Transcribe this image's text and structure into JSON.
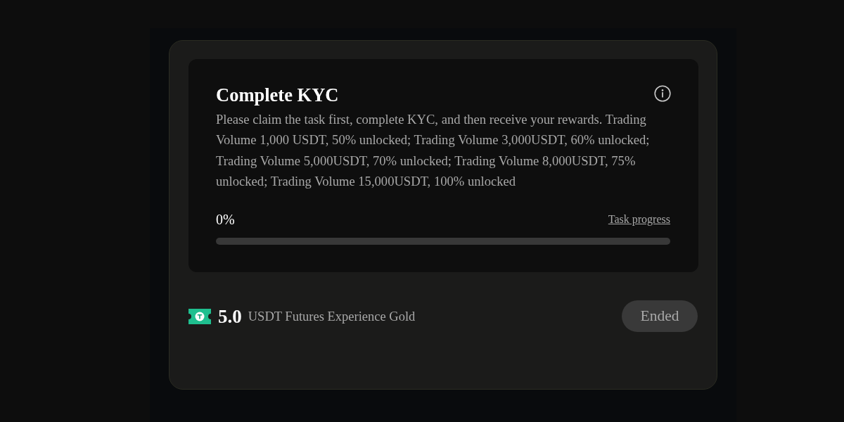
{
  "task": {
    "title": "Complete KYC",
    "description": "Please claim the task first, complete KYC, and then receive your rewards. Trading Volume 1,000 USDT, 50% unlocked; Trading Volume 3,000USDT, 60% unlocked; Trading Volume 5,000USDT, 70% unlocked; Trading Volume 8,000USDT, 75% unlocked; Trading Volume 15,000USDT, 100% unlocked",
    "progress": {
      "value": "0%",
      "link": "Task progress",
      "level": 0
    }
  },
  "reward": {
    "amount": "5.0",
    "name": "USDT Futures Experience Gold",
    "button": {
      "label": "Ended",
      "disabled": true
    }
  }
}
